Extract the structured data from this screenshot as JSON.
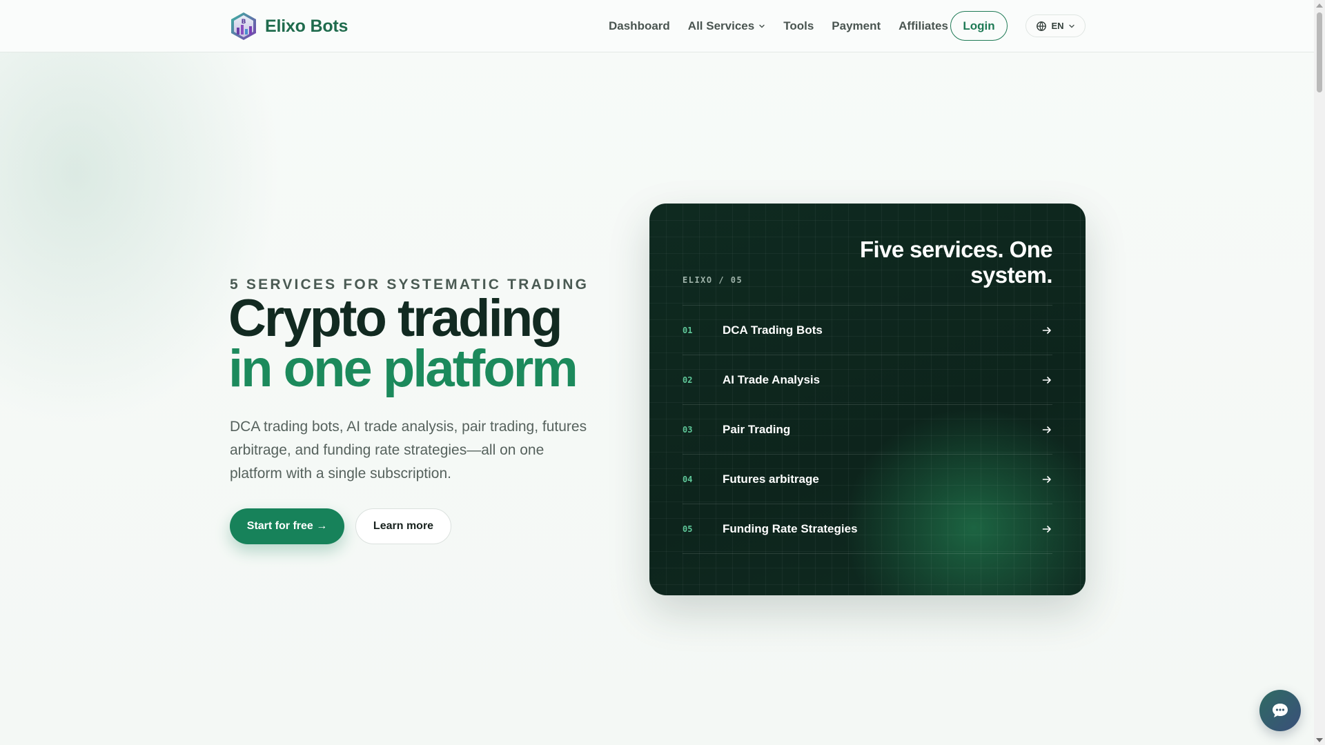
{
  "brand": {
    "name": "Elixo Bots",
    "logo_letter": "B"
  },
  "nav": {
    "items": [
      "Dashboard",
      "All Services",
      "Tools",
      "Payment",
      "Affiliates"
    ],
    "login_label": "Login",
    "language": "EN"
  },
  "hero": {
    "eyebrow": "5 SERVICES FOR SYSTEMATIC TRADING",
    "headline_line1": "Crypto trading",
    "headline_line2": "in one platform",
    "subtext": "DCA trading bots, AI trade analysis, pair trading, futures arbitrage, and funding rate strategies—all on one platform with a single subscription.",
    "primary_cta": "Start for free →",
    "secondary_cta": "Learn more"
  },
  "services_card": {
    "tag": "ELIXO / 05",
    "title": "Five services. One system.",
    "items": [
      {
        "num": "01",
        "name": "DCA Trading Bots"
      },
      {
        "num": "02",
        "name": "AI Trade Analysis"
      },
      {
        "num": "03",
        "name": "Pair Trading"
      },
      {
        "num": "04",
        "name": "Futures arbitrage"
      },
      {
        "num": "05",
        "name": "Funding Rate Strategies"
      }
    ]
  },
  "colors": {
    "accent": "#1c8a5c",
    "card_bg": "#0f2a20",
    "headline_dark": "#122a21"
  },
  "icons": {
    "logo": "hexagon-logo-icon",
    "dropdown": "chevron-down-icon",
    "language": "globe-icon",
    "service_arrow": "arrow-right-icon",
    "chat": "chat-bubble-icon"
  }
}
